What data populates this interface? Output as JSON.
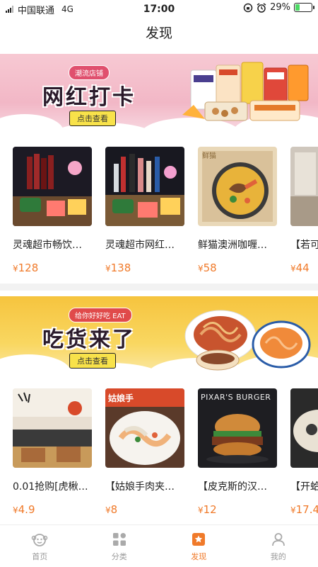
{
  "status": {
    "carrier": "中国联通",
    "network": "4G",
    "time": "17:00",
    "battery": "29%",
    "battery_level": 0.29
  },
  "page": {
    "title": "发现"
  },
  "banners": [
    {
      "tag": "潮流店铺",
      "title": "网红打卡",
      "cta": "点击查看"
    },
    {
      "tag": "给你好好吃 EAT",
      "title": "吃货来了",
      "cta": "点击查看"
    }
  ],
  "rows": [
    {
      "items": [
        {
          "name": "灵魂超市畅饮…",
          "price": "128"
        },
        {
          "name": "灵魂超市网红…",
          "price": "138"
        },
        {
          "name": "鲜猫澳洲咖喱…",
          "price": "58"
        },
        {
          "name": "【若可",
          "price": "44"
        }
      ]
    },
    {
      "items": [
        {
          "name": "0.01抢购[虎楸…",
          "price": "4.9"
        },
        {
          "name": "【姑娘手肉夹…",
          "price": "8"
        },
        {
          "name": "【皮克斯的汉…",
          "price": "12"
        },
        {
          "name": "【开蛤",
          "price": "17.4"
        }
      ]
    }
  ],
  "thumb_text": {
    "curry_sign": "鲜猫",
    "burger_sign": "PIXAR'S BURGER",
    "shop_sign": "姑娘手"
  },
  "currency": "¥",
  "tabs": [
    {
      "label": "首页",
      "icon": "monkey-face-icon"
    },
    {
      "label": "分类",
      "icon": "grid-icon"
    },
    {
      "label": "发现",
      "icon": "star-icon"
    },
    {
      "label": "我的",
      "icon": "user-icon"
    }
  ],
  "colors": {
    "accent": "#f07a2a",
    "banner1": "#f2b7c6",
    "banner2": "#f6c43e",
    "cta": "#f8e24a"
  }
}
